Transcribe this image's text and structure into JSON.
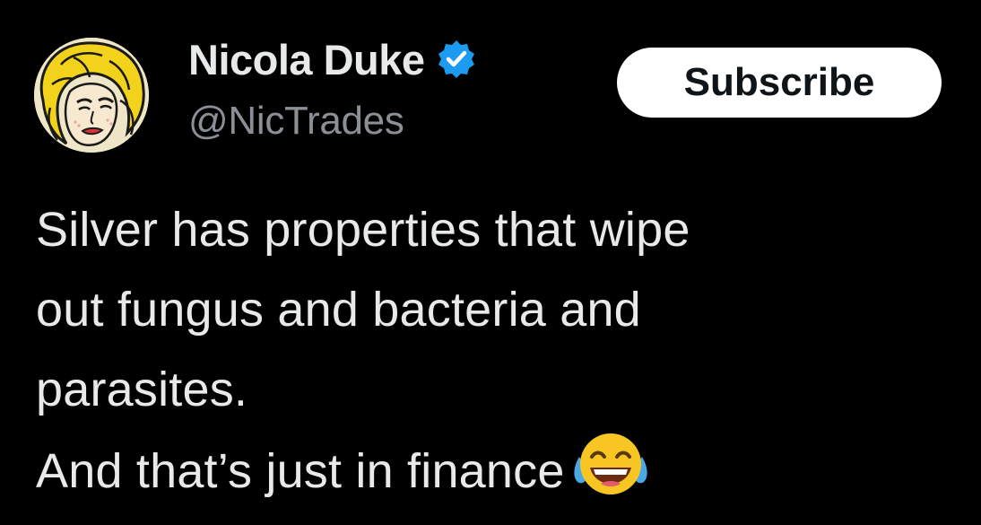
{
  "author": {
    "display_name": "Nicola Duke",
    "handle": "@NicTrades",
    "verified": true,
    "verified_icon": "verified-badge-icon",
    "avatar_icon": "comic-portrait-avatar"
  },
  "actions": {
    "subscribe_label": "Subscribe"
  },
  "tweet": {
    "lines": [
      "Silver has properties that wipe",
      "out fungus and bacteria and",
      "parasites.",
      "And that’s just in finance"
    ],
    "emoji": "face-with-tears-of-joy-icon"
  },
  "colors": {
    "background": "#000000",
    "text": "#e7e9ea",
    "secondary_text": "#8b9096",
    "verified_blue": "#1d9bf0",
    "button_bg": "#ffffff",
    "button_text": "#0f1419"
  }
}
